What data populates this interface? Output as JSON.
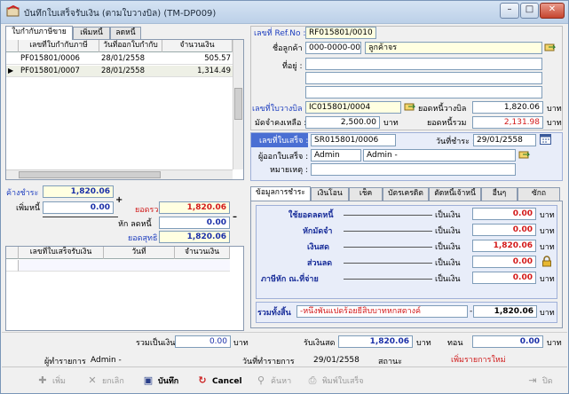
{
  "window": {
    "title": "บันทึกใบเสร็จรับเงิน (ตามใบวางบิล) (TM-DP009)",
    "minimize": "–",
    "maximize": "□",
    "close": "✕"
  },
  "left_tabs": [
    "ใบกำกับภาษีขาย",
    "เพิ่มหนี้",
    "ลดหนี้"
  ],
  "invoice_grid": {
    "headers": [
      "เลขที่ใบกำกับภาษี",
      "วันที่ออกใบกำกับ",
      "จำนวนเงิน"
    ],
    "rows": [
      {
        "marker": "",
        "no": "PF015801/0006",
        "date": "28/01/2558",
        "amount": "505.57"
      },
      {
        "marker": "▶",
        "no": "PF015801/0007",
        "date": "28/01/2558",
        "amount": "1,314.49"
      }
    ]
  },
  "summary_left": {
    "due_label": "ค้างชำระ",
    "due_value": "1,820.06",
    "add_label": "เพิ่มหนี้",
    "add_value": "0.00",
    "plus": "+",
    "total_label": "ยอดรวม",
    "total_value": "1,820.06",
    "deduct_label": "หัก ลดหนี้",
    "deduct_value": "0.00",
    "minus": "–",
    "net_label": "ยอดสุทธิ",
    "net_value": "1,820.06"
  },
  "receipt_grid": {
    "headers": [
      "เลขที่ใบเสร็จรับเงิน",
      "วันที่",
      "จำนวนเงิน"
    ]
  },
  "header_form": {
    "ref_label": "เลขที่ Ref.No :",
    "ref_value": "RF015801/0010",
    "customer_label": "ชื่อลูกค้า :",
    "customer_code": "000-0000-00000",
    "customer_name": "ลูกค้าจร",
    "address_label": "ที่อยู่ :",
    "bill_label": "เลขที่ใบวางบิล :",
    "bill_value": "IC015801/0004",
    "bill_total_label": "ยอดหนี้วางบิล",
    "bill_total_value": "1,820.06",
    "bill_total_unit": "บาท",
    "deposit_label": "มัดจำคงเหลือ :",
    "deposit_value": "2,500.00",
    "deposit_unit": "บาท",
    "debt_label": "ยอดหนี้รวม",
    "debt_value": "2,131.98",
    "debt_unit": "บาท"
  },
  "receipt_form": {
    "receipt_label": "เลขที่ใบเสร็จ :",
    "receipt_value": "SR015801/0006",
    "paydate_label": "วันที่ชำระ :",
    "paydate_value": "29/01/2558",
    "issuer_label": "ผู้ออกใบเสร็จ :",
    "issuer_code": "Admin",
    "issuer_name": "Admin -",
    "note_label": "หมายเหตุ :"
  },
  "pay_tabs": [
    "ข้อมูลการชำระ",
    "เงินโอน",
    "เช็ค",
    "บัตรเครดิต",
    "ตัดหนี้เจ้าหนี้",
    "อื่นๆ",
    "ซักถ"
  ],
  "payment": {
    "rows": [
      {
        "label": "ใช้ยอดลดหนี้",
        "as": "เป็นเงิน",
        "value": "0.00",
        "unit": "บาท"
      },
      {
        "label": "หักมัดจำ",
        "as": "เป็นเงิน",
        "value": "0.00",
        "unit": "บาท"
      },
      {
        "label": "เงินสด",
        "as": "เป็นเงิน",
        "value": "1,820.06",
        "unit": "บาท"
      },
      {
        "label": "ส่วนลด",
        "as": "เป็นเงิน",
        "value": "0.00",
        "unit": "บาท"
      },
      {
        "label": "ภาษีหัก ณ.ที่จ่าย",
        "as": "เป็นเงิน",
        "value": "0.00",
        "unit": "บาท"
      }
    ],
    "sum_label": "รวมทั้งสิ้น",
    "sum_text": "-หนึ่งพันแปดร้อยยี่สิบบาทหกสตางค์",
    "sum_value": "1,820.06",
    "sum_unit": "บาท"
  },
  "footer": {
    "total_label": "รวมเป็นเงิน",
    "total_value": "0.00",
    "total_unit": "บาท",
    "cash_label": "รับเงินสด",
    "cash_value": "1,820.06",
    "cash_unit": "บาท",
    "change_label": "ทอน",
    "change_value": "0.00",
    "change_unit": "บาท",
    "recorder_label": "ผู้ทำรายการ",
    "recorder_value": "Admin -",
    "txdate_label": "วันที่ทำรายการ",
    "txdate_value": "29/01/2558",
    "status_label": "สถานะ",
    "status_value": "เพิ่มรายการใหม่"
  },
  "toolbar": {
    "add": "เพิ่ม",
    "cancel_doc": "ยกเลิก",
    "save": "บันทึก",
    "cancel": "Cancel",
    "search": "ค้นหา",
    "print": "พิมพ์ใบเสร็จ",
    "close": "ปิด"
  },
  "colors": {
    "accent_blue": "#1f3fbf",
    "value_red": "#d31a1a",
    "highlight_blue": "#4a6fd3"
  }
}
